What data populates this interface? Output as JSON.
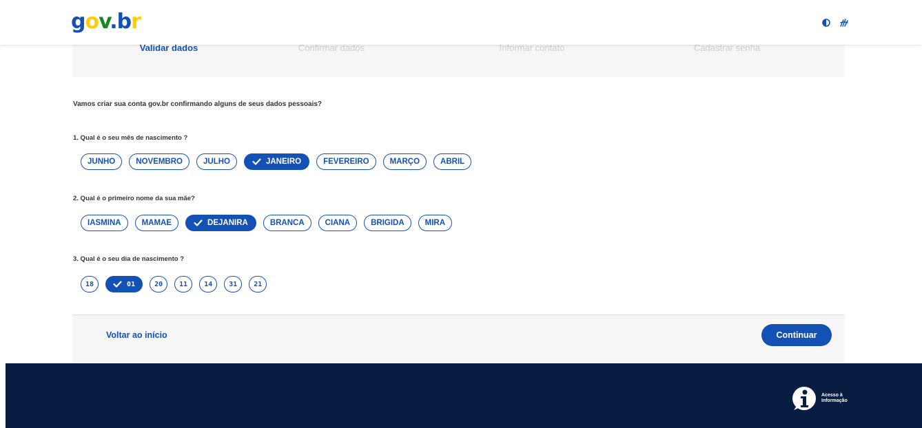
{
  "logo": {
    "g": "g",
    "o": "o",
    "v": "v",
    "dot": ".",
    "b": "b",
    "r": "r"
  },
  "header": {
    "contrast_icon": "contrast-icon",
    "libras_icon": "sign-language-icon"
  },
  "steps": [
    {
      "label": "Validar dados",
      "active": true
    },
    {
      "label": "Confirmar dados",
      "active": false
    },
    {
      "label": "Informar contato",
      "active": false
    },
    {
      "label": "Cadastrar senha",
      "active": false
    }
  ],
  "intro": "Vamos criar sua conta gov.br confirmando alguns de seus dados pessoais?",
  "questions": [
    {
      "label": "1. Qual é o seu mês de nascimento ?",
      "options": [
        "JUNHO",
        "NOVEMBRO",
        "JULHO",
        "JANEIRO",
        "FEVEREIRO",
        "MARÇO",
        "ABRIL"
      ],
      "selected": "JANEIRO"
    },
    {
      "label": "2. Qual é o primeiro nome da sua mãe?",
      "options": [
        "IASMINA",
        "MAMAE",
        "DEJANIRA",
        "BRANCA",
        "CIANA",
        "BRIGIDA",
        "MIRA"
      ],
      "selected": "DEJANIRA"
    },
    {
      "label": "3. Qual é o seu dia de nascimento ?",
      "options": [
        "18",
        "01",
        "20",
        "11",
        "14",
        "31",
        "21"
      ],
      "selected": "01"
    }
  ],
  "actions": {
    "back": "Voltar ao início",
    "continue": "Continuar"
  },
  "footer": {
    "acesso_line1": "Acesso à",
    "acesso_line2": "Informação"
  },
  "colors": {
    "primary": "#1351b4",
    "footer_bg": "#071d41",
    "gray_bg": "#f6f6f6"
  }
}
